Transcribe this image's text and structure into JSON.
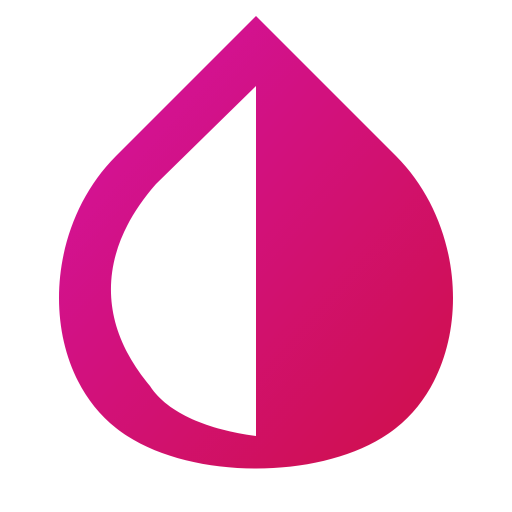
{
  "logo": {
    "icon": "half-drop-icon",
    "colors": {
      "gradient_start": "#d412a6",
      "gradient_end": "#cf1048",
      "inner": "#ffffff",
      "background": "#ffffff"
    }
  }
}
